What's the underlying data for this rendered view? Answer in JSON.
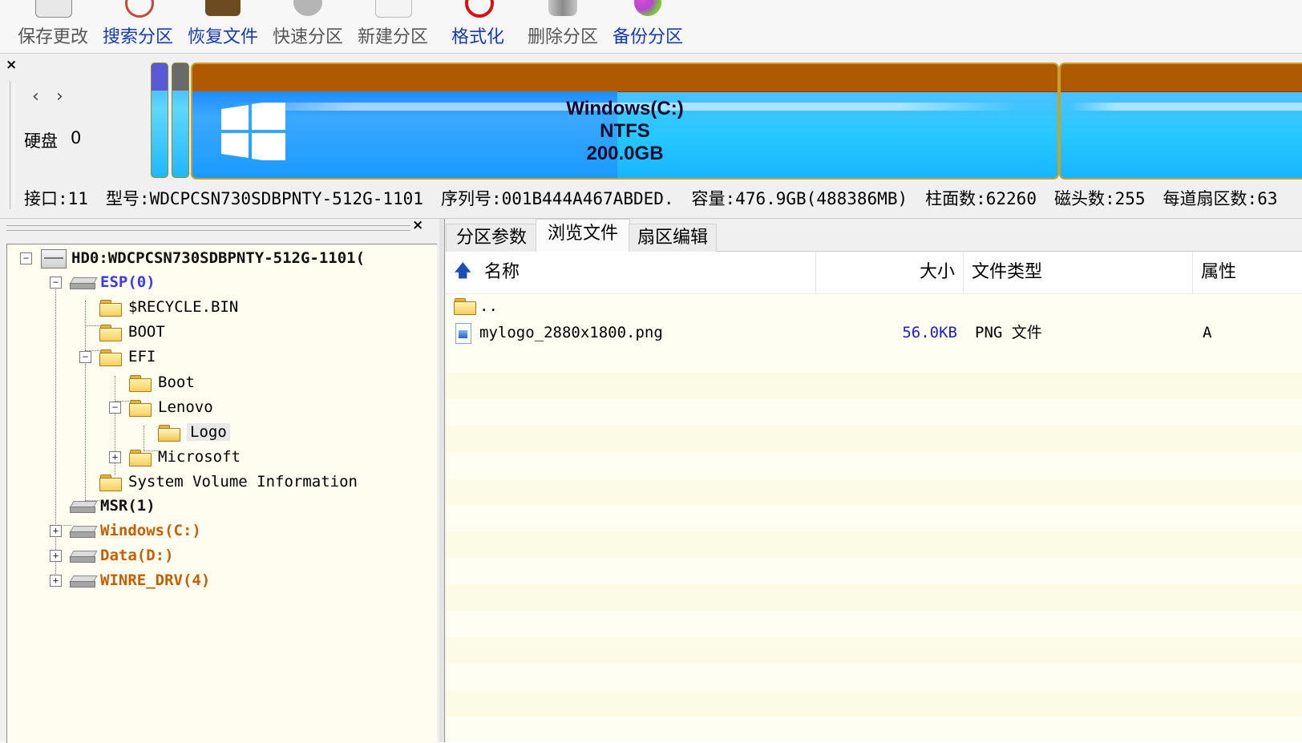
{
  "toolbar": {
    "items": [
      {
        "label": "保存更改",
        "icon": "save-icon",
        "color": "#5a6ea0",
        "label_color": "#555555"
      },
      {
        "label": "搜索分区",
        "icon": "search-partition-icon",
        "color": "#c24a3a",
        "label_color": "#1a3aa8"
      },
      {
        "label": "恢复文件",
        "icon": "recover-files-icon",
        "color": "#6d4a22",
        "label_color": "#1a3aa8"
      },
      {
        "label": "快速分区",
        "icon": "quick-partition-icon",
        "color": "#9a9a9a",
        "label_color": "#555555"
      },
      {
        "label": "新建分区",
        "icon": "new-partition-icon",
        "color": "#d0d0d0",
        "label_color": "#555555"
      },
      {
        "label": "格式化",
        "icon": "format-icon",
        "color": "#d41010",
        "label_color": "#1a3aa8"
      },
      {
        "label": "删除分区",
        "icon": "delete-partition-icon",
        "color": "#a0a0a0",
        "label_color": "#555555"
      },
      {
        "label": "备份分区",
        "icon": "backup-partition-icon",
        "color": "#b04ad0",
        "label_color": "#1a3aa8"
      }
    ]
  },
  "disk": {
    "label": "硬盘",
    "number": "0",
    "partition": {
      "name": "Windows(C:)",
      "fs": "NTFS",
      "size": "200.0GB"
    },
    "info": {
      "interface": "接口:11",
      "model": "型号:WDCPCSN730SDBPNTY-512G-1101",
      "serial": "序列号:001B444A467ABDED.",
      "capacity": "容量:476.9GB(488386MB)",
      "cylinders": "柱面数:62260",
      "heads": "磁头数:255",
      "sectors": "每道扇区数:63"
    }
  },
  "tree": {
    "root": "HD0:WDCPCSN730SDBPNTY-512G-1101(",
    "esp": "ESP(0)",
    "recycle": "$RECYCLE.BIN",
    "boot_dir": "BOOT",
    "efi": "EFI",
    "boot_sub": "Boot",
    "lenovo": "Lenovo",
    "logo": "Logo",
    "microsoft": "Microsoft",
    "svi": "System Volume Information",
    "msr": "MSR(1)",
    "windows": "Windows(C:)",
    "data": "Data(D:)",
    "winre": "WINRE_DRV(4)"
  },
  "tabs": {
    "partition_params": "分区参数",
    "browse_files": "浏览文件",
    "sector_edit": "扇区编辑"
  },
  "columns": {
    "name": "名称",
    "size": "大小",
    "type": "文件类型",
    "attr": "属性"
  },
  "files": [
    {
      "name": "..",
      "size": "",
      "type": "",
      "attr": ""
    },
    {
      "name": "mylogo_2880x1800.png",
      "size": "56.0KB",
      "type": "PNG 文件",
      "attr": "A"
    }
  ]
}
